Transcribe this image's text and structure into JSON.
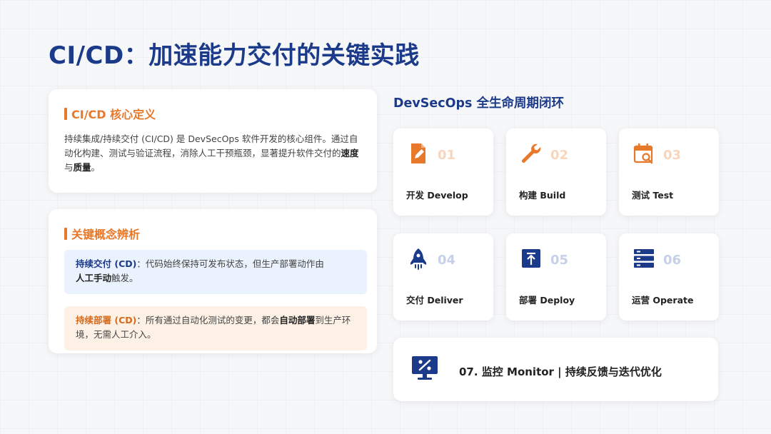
{
  "slide_title": "CI/CD：加速能力交付的关键实践",
  "definition": {
    "heading": "CI/CD 核心定义",
    "text_part1": "持续集成/持续交付 (CI/CD) 是 DevSecOps 软件开发的核心组件。通过自动化构建、测试与验证流程，消除人工干预瓶颈，显著提升软件交付的",
    "emph1": "速度",
    "connector": "与",
    "emph2": "质量",
    "end": "。"
  },
  "concepts": {
    "heading": "关键概念辨析",
    "cd_delivery": {
      "lead": "持续交付 (CD)",
      "colon": "：",
      "text": "代码始终保持可发布状态，但生产部署动作由",
      "emph": "人工手动",
      "tail": "触发。"
    },
    "cd_deployment": {
      "lead": "持续部署 (CD)",
      "colon": "：",
      "text": "所有通过自动化测试的变更，都会",
      "emph": "自动部署",
      "tail": "到生产环境，无需人工介入。"
    }
  },
  "lifecycle": {
    "title": "DevSecOps 全生命周期闭环",
    "steps": [
      {
        "num": "01",
        "label": "开发 Develop",
        "icon": "edit-document-icon",
        "color": "#e8782a"
      },
      {
        "num": "02",
        "label": "构建 Build",
        "icon": "wrench-icon",
        "color": "#e8782a"
      },
      {
        "num": "03",
        "label": "测试 Test",
        "icon": "calendar-search-icon",
        "color": "#e8782a"
      },
      {
        "num": "04",
        "label": "交付 Deliver",
        "icon": "rocket-icon",
        "color": "#1c3a8a"
      },
      {
        "num": "05",
        "label": "部署 Deploy",
        "icon": "upload-box-icon",
        "color": "#1c3a8a"
      },
      {
        "num": "06",
        "label": "运营 Operate",
        "icon": "server-icon",
        "color": "#1c3a8a"
      }
    ],
    "monitor": {
      "label": "07. 监控 Monitor | 持续反馈与迭代优化",
      "icon": "monitor-percent-icon",
      "color": "#1c3a8a"
    }
  }
}
